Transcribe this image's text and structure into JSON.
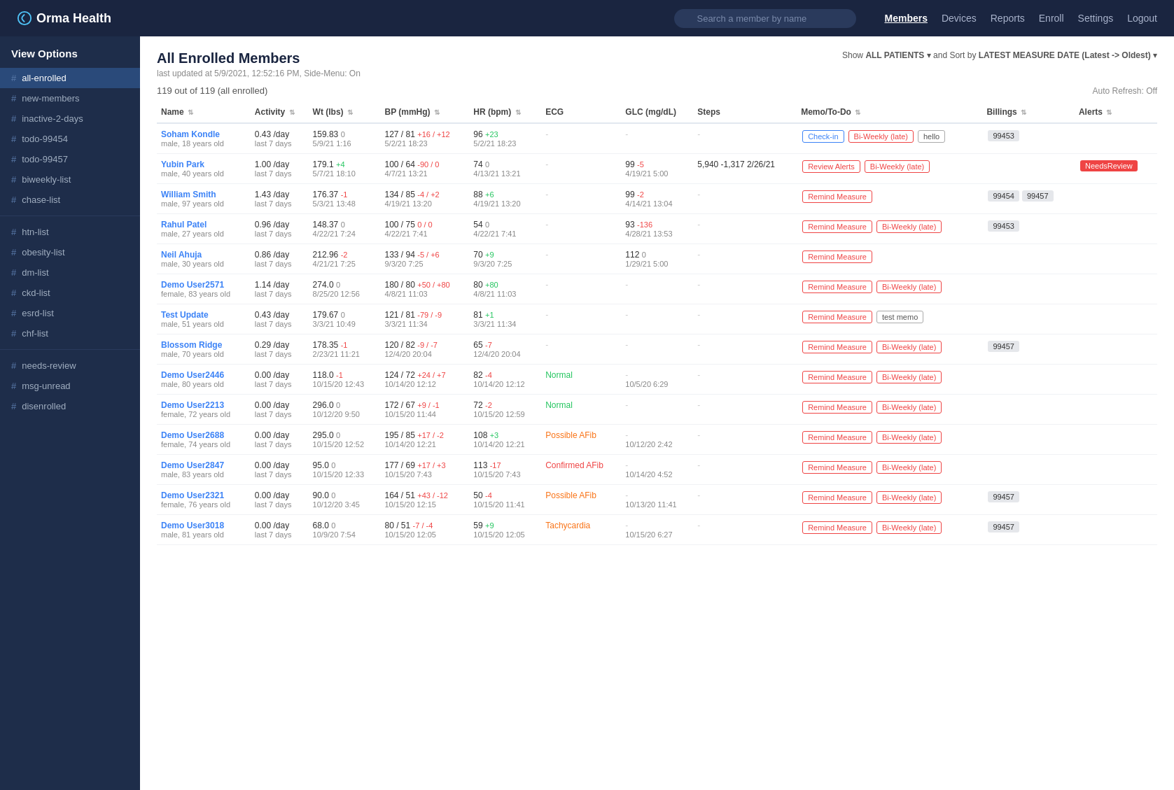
{
  "nav": {
    "logo": "Orma Health",
    "search_placeholder": "Search a member by name",
    "links": [
      {
        "label": "Members",
        "active": true
      },
      {
        "label": "Devices",
        "active": false
      },
      {
        "label": "Reports",
        "active": false
      },
      {
        "label": "Enroll",
        "active": false
      },
      {
        "label": "Settings",
        "active": false
      },
      {
        "label": "Logout",
        "active": false
      }
    ]
  },
  "sidebar": {
    "title": "View Options",
    "items": [
      {
        "label": "all-enrolled",
        "active": true
      },
      {
        "label": "new-members",
        "active": false
      },
      {
        "label": "inactive-2-days",
        "active": false
      },
      {
        "label": "todo-99454",
        "active": false
      },
      {
        "label": "todo-99457",
        "active": false
      },
      {
        "label": "biweekly-list",
        "active": false
      },
      {
        "label": "chase-list",
        "active": false
      },
      {
        "label": "htn-list",
        "active": false
      },
      {
        "label": "obesity-list",
        "active": false
      },
      {
        "label": "dm-list",
        "active": false
      },
      {
        "label": "ckd-list",
        "active": false
      },
      {
        "label": "esrd-list",
        "active": false
      },
      {
        "label": "chf-list",
        "active": false
      },
      {
        "label": "needs-review",
        "active": false
      },
      {
        "label": "msg-unread",
        "active": false
      },
      {
        "label": "disenrolled",
        "active": false
      }
    ]
  },
  "page": {
    "title": "All Enrolled Members",
    "subtitle": "last updated at 5/9/2021, 12:52:16 PM, Side-Menu: On",
    "count": "119 out of 119 (all enrolled)",
    "filter": "Show ALL PATIENTS and Sort by LATEST MEASURE DATE (Latest -> Oldest)",
    "auto_refresh": "Auto Refresh: Off"
  },
  "table": {
    "columns": [
      "Name",
      "Activity",
      "Wt (lbs)",
      "BP (mmHg)",
      "HR (bpm)",
      "ECG",
      "GLC (mg/dL)",
      "Steps",
      "Memo/To-Do",
      "Billings",
      "Alerts"
    ],
    "rows": [
      {
        "name": "Soham Kondle",
        "sub": "male, 18 years old",
        "activity": "0.43 /day",
        "activity_sub": "last 7 days",
        "wt": "159.83",
        "wt_d": "0",
        "wt_sub": "5/9/21 1:16",
        "bp": "127 / 81",
        "bp_d": "+16 / +12",
        "bp_sub": "5/2/21 18:23",
        "hr": "96",
        "hr_d": "+23",
        "hr_sub": "5/2/21 18:23",
        "ecg": "-",
        "glc": "-",
        "glc_d": "",
        "glc_sub": "",
        "steps": "-",
        "memos": [
          {
            "label": "Check-in",
            "type": "outline-blue"
          },
          {
            "label": "Bi-Weekly (late)",
            "type": "outline-red"
          },
          {
            "label": "hello",
            "type": "outline-gray"
          }
        ],
        "billings": [
          "99453"
        ],
        "alerts": ""
      },
      {
        "name": "Yubin Park",
        "sub": "male, 40 years old",
        "activity": "1.00 /day",
        "activity_sub": "last 7 days",
        "wt": "179.1",
        "wt_d": "+4",
        "wt_sub": "5/7/21 18:10",
        "bp": "100 / 64",
        "bp_d": "-90 / 0",
        "bp_sub": "4/7/21 13:21",
        "hr": "74",
        "hr_d": "0",
        "hr_sub": "4/13/21 13:21",
        "ecg": "-",
        "glc": "99",
        "glc_d": "-5",
        "glc_sub": "4/19/21 5:00",
        "steps": "5,940 -1,317\n2/26/21",
        "memos": [
          {
            "label": "Review Alerts",
            "type": "outline-red"
          },
          {
            "label": "Bi-Weekly (late)",
            "type": "outline-red"
          }
        ],
        "billings": [],
        "alerts": "NeedsReview"
      },
      {
        "name": "William Smith",
        "sub": "male, 97 years old",
        "activity": "1.43 /day",
        "activity_sub": "last 7 days",
        "wt": "176.37",
        "wt_d": "-1",
        "wt_sub": "5/3/21 13:48",
        "bp": "134 / 85",
        "bp_d": "-4 / +2",
        "bp_sub": "4/19/21 13:20",
        "hr": "88",
        "hr_d": "+6",
        "hr_sub": "4/19/21 13:20",
        "ecg": "-",
        "glc": "99",
        "glc_d": "-2",
        "glc_sub": "4/14/21 13:04",
        "steps": "-",
        "memos": [
          {
            "label": "Remind Measure",
            "type": "outline-red"
          }
        ],
        "billings": [
          "99454",
          "99457"
        ],
        "alerts": ""
      },
      {
        "name": "Rahul Patel",
        "sub": "male, 27 years old",
        "activity": "0.96 /day",
        "activity_sub": "last 7 days",
        "wt": "148.37",
        "wt_d": "0",
        "wt_sub": "4/22/21 7:24",
        "bp": "100 / 75",
        "bp_d": "0 / 0",
        "bp_sub": "4/22/21 7:41",
        "hr": "54",
        "hr_d": "0",
        "hr_sub": "4/22/21 7:41",
        "ecg": "-",
        "glc": "93",
        "glc_d": "-136",
        "glc_sub": "4/28/21 13:53",
        "steps": "-",
        "memos": [
          {
            "label": "Remind Measure",
            "type": "outline-red"
          },
          {
            "label": "Bi-Weekly (late)",
            "type": "outline-red"
          }
        ],
        "billings": [
          "99453"
        ],
        "alerts": ""
      },
      {
        "name": "Neil Ahuja",
        "sub": "male, 30 years old",
        "activity": "0.86 /day",
        "activity_sub": "last 7 days",
        "wt": "212.96",
        "wt_d": "-2",
        "wt_sub": "4/21/21 7:25",
        "bp": "133 / 94",
        "bp_d": "-5 / +6",
        "bp_sub": "9/3/20 7:25",
        "hr": "70",
        "hr_d": "+9",
        "hr_sub": "9/3/20 7:25",
        "ecg": "-",
        "glc": "112",
        "glc_d": "0",
        "glc_sub": "1/29/21 5:00",
        "steps": "-",
        "memos": [
          {
            "label": "Remind Measure",
            "type": "outline-red"
          }
        ],
        "billings": [],
        "alerts": ""
      },
      {
        "name": "Demo User2571",
        "sub": "female, 83 years old",
        "activity": "1.14 /day",
        "activity_sub": "last 7 days",
        "wt": "274.0",
        "wt_d": "0",
        "wt_sub": "8/25/20 12:56",
        "bp": "180 / 80",
        "bp_d": "+50 / +80",
        "bp_sub": "4/8/21 11:03",
        "hr": "80",
        "hr_d": "+80",
        "hr_sub": "4/8/21 11:03",
        "ecg": "-",
        "glc": "-",
        "glc_d": "",
        "glc_sub": "",
        "steps": "-",
        "memos": [
          {
            "label": "Remind Measure",
            "type": "outline-red"
          },
          {
            "label": "Bi-Weekly (late)",
            "type": "outline-red"
          }
        ],
        "billings": [],
        "alerts": ""
      },
      {
        "name": "Test Update",
        "sub": "male, 51 years old",
        "activity": "0.43 /day",
        "activity_sub": "last 7 days",
        "wt": "179.67",
        "wt_d": "0",
        "wt_sub": "3/3/21 10:49",
        "bp": "121 / 81",
        "bp_d": "-79 / -9",
        "bp_sub": "3/3/21 11:34",
        "hr": "81",
        "hr_d": "+1",
        "hr_sub": "3/3/21 11:34",
        "ecg": "-",
        "glc": "-",
        "glc_d": "",
        "glc_sub": "",
        "steps": "-",
        "memos": [
          {
            "label": "Remind Measure",
            "type": "outline-red"
          },
          {
            "label": "test memo",
            "type": "outline-gray"
          }
        ],
        "billings": [],
        "alerts": ""
      },
      {
        "name": "Blossom Ridge",
        "sub": "male, 70 years old",
        "activity": "0.29 /day",
        "activity_sub": "last 7 days",
        "wt": "178.35",
        "wt_d": "-1",
        "wt_sub": "2/23/21 11:21",
        "bp": "120 / 82",
        "bp_d": "-9 / -7",
        "bp_sub": "12/4/20 20:04",
        "hr": "65",
        "hr_d": "-7",
        "hr_sub": "12/4/20 20:04",
        "ecg": "-",
        "glc": "-",
        "glc_d": "",
        "glc_sub": "",
        "steps": "-",
        "memos": [
          {
            "label": "Remind Measure",
            "type": "outline-red"
          },
          {
            "label": "Bi-Weekly (late)",
            "type": "outline-red"
          }
        ],
        "billings": [
          "99457"
        ],
        "alerts": ""
      },
      {
        "name": "Demo User2446",
        "sub": "male, 80 years old",
        "activity": "0.00 /day",
        "activity_sub": "last 7 days",
        "wt": "118.0",
        "wt_d": "-1",
        "wt_sub": "10/15/20 12:43",
        "bp": "124 / 72",
        "bp_d": "+24 / +7",
        "bp_sub": "10/14/20 12:12",
        "hr": "82",
        "hr_d": "-4",
        "hr_sub": "10/14/20 12:12",
        "ecg": "Normal",
        "ecg_type": "normal",
        "glc": "-",
        "glc_d": "",
        "glc_sub": "10/5/20 6:29",
        "steps": "-",
        "memos": [
          {
            "label": "Remind Measure",
            "type": "outline-red"
          },
          {
            "label": "Bi-Weekly (late)",
            "type": "outline-red"
          }
        ],
        "billings": [],
        "alerts": ""
      },
      {
        "name": "Demo User2213",
        "sub": "female, 72 years old",
        "activity": "0.00 /day",
        "activity_sub": "last 7 days",
        "wt": "296.0",
        "wt_d": "0",
        "wt_sub": "10/12/20 9:50",
        "bp": "172 / 67",
        "bp_d": "+9 / -1",
        "bp_sub": "10/15/20 11:44",
        "hr": "72",
        "hr_d": "-2",
        "hr_sub": "10/15/20 12:59",
        "ecg": "Normal",
        "ecg_type": "normal",
        "glc": "-",
        "glc_d": "",
        "glc_sub": "",
        "steps": "-",
        "memos": [
          {
            "label": "Remind Measure",
            "type": "outline-red"
          },
          {
            "label": "Bi-Weekly (late)",
            "type": "outline-red"
          }
        ],
        "billings": [],
        "alerts": ""
      },
      {
        "name": "Demo User2688",
        "sub": "female, 74 years old",
        "activity": "0.00 /day",
        "activity_sub": "last 7 days",
        "wt": "295.0",
        "wt_d": "0",
        "wt_sub": "10/15/20 12:52",
        "bp": "195 / 85",
        "bp_d": "+17 / -2",
        "bp_sub": "10/14/20 12:21",
        "hr": "108",
        "hr_d": "+3",
        "hr_sub": "10/14/20 12:21",
        "ecg": "Possible AFib",
        "ecg_type": "possible",
        "glc": "-",
        "glc_d": "",
        "glc_sub": "10/12/20 2:42",
        "steps": "-",
        "memos": [
          {
            "label": "Remind Measure",
            "type": "outline-red"
          },
          {
            "label": "Bi-Weekly (late)",
            "type": "outline-red"
          }
        ],
        "billings": [],
        "alerts": ""
      },
      {
        "name": "Demo User2847",
        "sub": "male, 83 years old",
        "activity": "0.00 /day",
        "activity_sub": "last 7 days",
        "wt": "95.0",
        "wt_d": "0",
        "wt_sub": "10/15/20 12:33",
        "bp": "177 / 69",
        "bp_d": "+17 / +3",
        "bp_sub": "10/15/20 7:43",
        "hr": "113",
        "hr_d": "-17",
        "hr_sub": "10/15/20 7:43",
        "ecg": "Confirmed AFib",
        "ecg_type": "confirmed",
        "glc": "-",
        "glc_d": "",
        "glc_sub": "10/14/20 4:52",
        "steps": "-",
        "memos": [
          {
            "label": "Remind Measure",
            "type": "outline-red"
          },
          {
            "label": "Bi-Weekly (late)",
            "type": "outline-red"
          }
        ],
        "billings": [],
        "alerts": ""
      },
      {
        "name": "Demo User2321",
        "sub": "female, 76 years old",
        "activity": "0.00 /day",
        "activity_sub": "last 7 days",
        "wt": "90.0",
        "wt_d": "0",
        "wt_sub": "10/12/20 3:45",
        "bp": "164 / 51",
        "bp_d": "+43 / -12",
        "bp_sub": "10/15/20 12:15",
        "hr": "50",
        "hr_d": "-4",
        "hr_sub": "10/15/20 11:41",
        "ecg": "Possible AFib",
        "ecg_type": "possible",
        "glc": "-",
        "glc_d": "",
        "glc_sub": "10/13/20 11:41",
        "steps": "-",
        "memos": [
          {
            "label": "Remind Measure",
            "type": "outline-red"
          },
          {
            "label": "Bi-Weekly (late)",
            "type": "outline-red"
          }
        ],
        "billings": [
          "99457"
        ],
        "alerts": ""
      },
      {
        "name": "Demo User3018",
        "sub": "male, 81 years old",
        "activity": "0.00 /day",
        "activity_sub": "last 7 days",
        "wt": "68.0",
        "wt_d": "0",
        "wt_sub": "10/9/20 7:54",
        "bp": "80 / 51",
        "bp_d": "-7 / -4",
        "bp_sub": "10/15/20 12:05",
        "hr": "59",
        "hr_d": "+9",
        "hr_sub": "10/15/20 12:05",
        "ecg": "Tachycardia",
        "ecg_type": "tachy",
        "glc": "-",
        "glc_d": "",
        "glc_sub": "10/15/20 6:27",
        "steps": "-",
        "memos": [
          {
            "label": "Remind Measure",
            "type": "outline-red"
          },
          {
            "label": "Bi-Weekly (late)",
            "type": "outline-red"
          }
        ],
        "billings": [
          "99457"
        ],
        "alerts": ""
      }
    ]
  }
}
